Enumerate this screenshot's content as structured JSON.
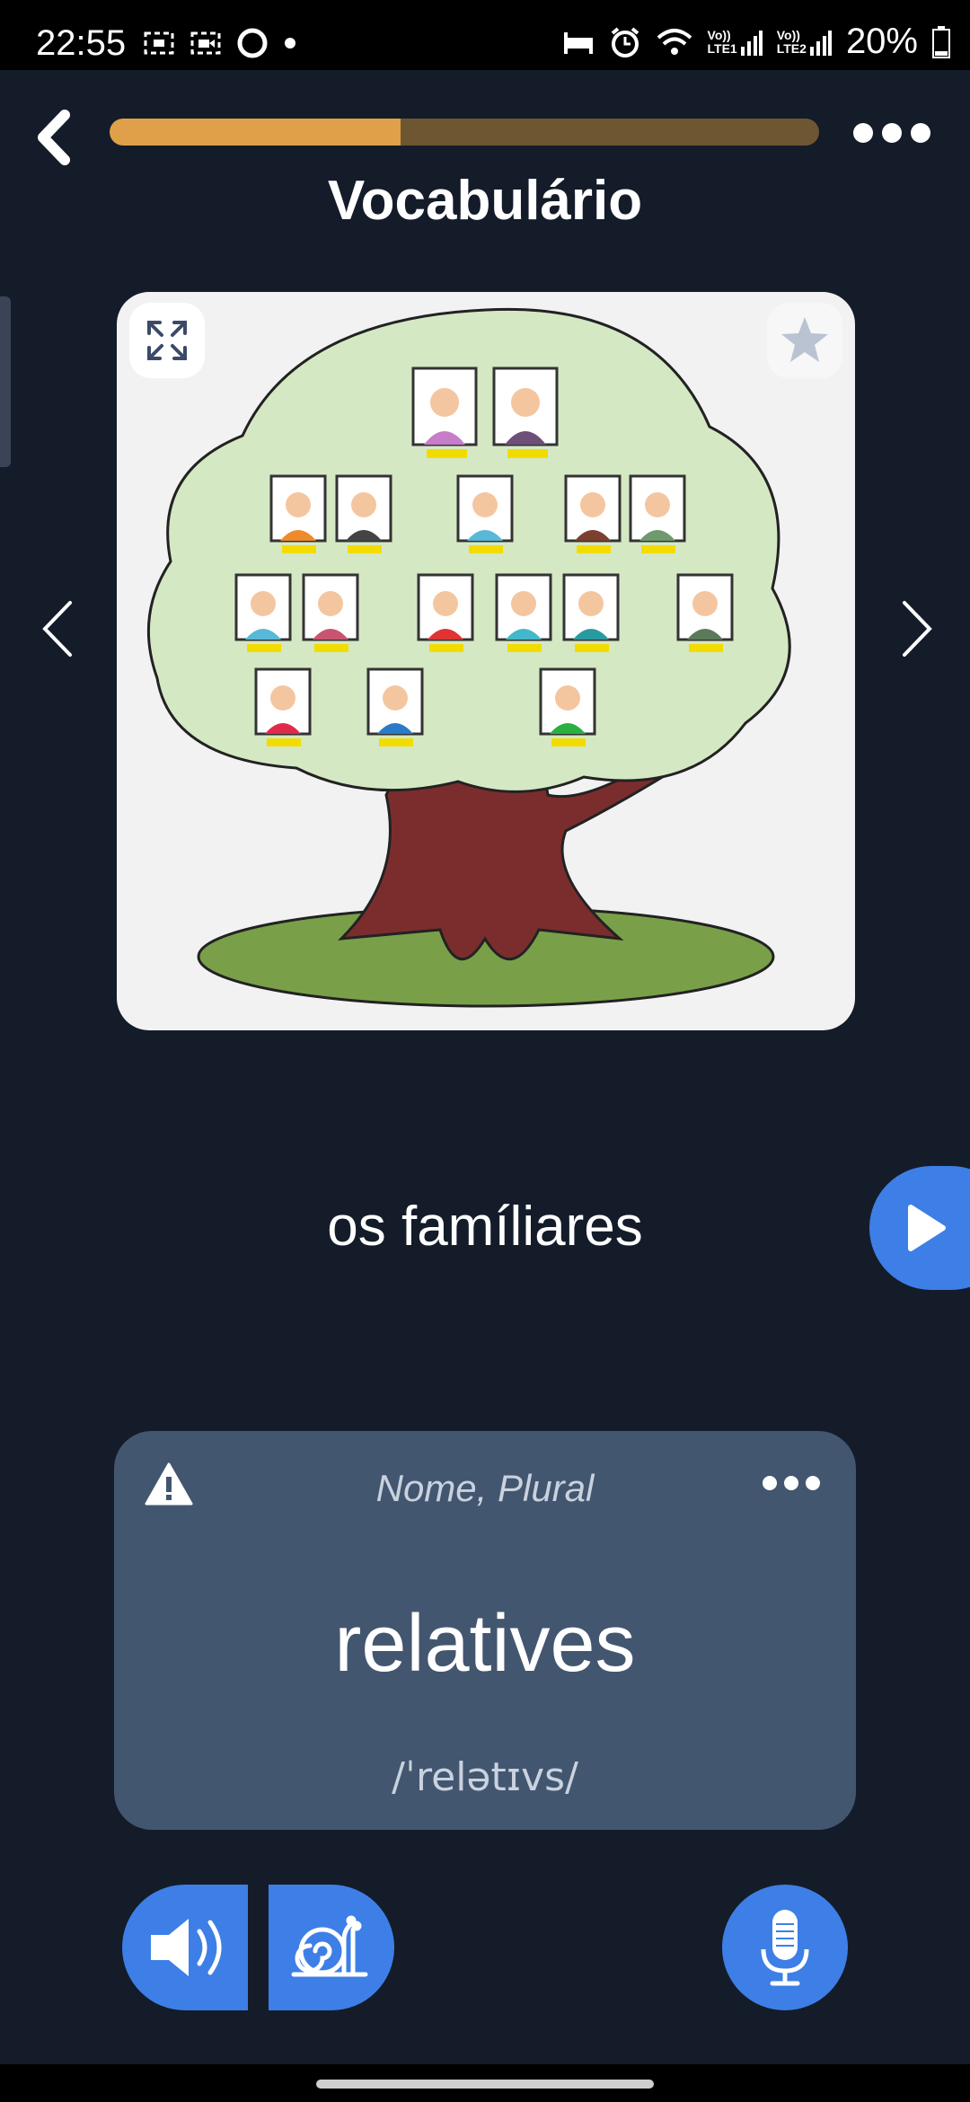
{
  "status_bar": {
    "time": "22:55",
    "battery": "20%",
    "icons": [
      "screenshot-icon",
      "screen-record-icon",
      "edge-icon",
      "notification-dot-icon",
      "sleep-icon",
      "alarm-icon",
      "wifi-icon",
      "volte-lte1-signal-icon",
      "volte-lte2-signal-icon",
      "battery-icon"
    ],
    "lte1": "LTE1",
    "lte2": "LTE2",
    "vo": "Vo))"
  },
  "header": {
    "title": "Vocabulário",
    "progress": 0.41,
    "progress_color": "#e0a04a",
    "progress_track_color": "#6e5632"
  },
  "card": {
    "word_source": "os famíliares",
    "part_of_speech": "Nome, Plural",
    "translation": "relatives",
    "phonetic": "/ˈrelətɪvs/"
  },
  "colors": {
    "background": "#141c2a",
    "card": "#435670",
    "accent_blue": "#3d7fe6"
  }
}
